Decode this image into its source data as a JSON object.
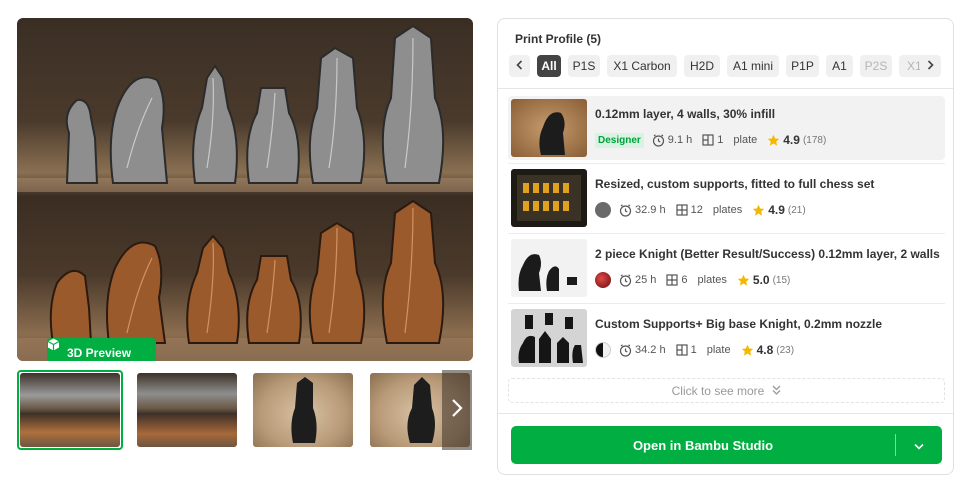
{
  "gallery": {
    "preview_button_label": "3D Preview",
    "thumbnails": [
      "thumbnail-1",
      "thumbnail-2",
      "thumbnail-3",
      "thumbnail-4"
    ],
    "selected_thumbnail": 1
  },
  "print_profile": {
    "title": "Print Profile (5)",
    "filters": [
      "All",
      "P1S",
      "X1 Carbon",
      "H2D",
      "A1 mini",
      "P1P",
      "A1",
      "P2S",
      "X1"
    ],
    "active_filter": "All",
    "items": [
      {
        "name": "0.12mm layer, 4 walls, 30% infill",
        "badge": "Designer",
        "time": "9.1 h",
        "plates_count": "1",
        "plates_label": "plate",
        "rating": "4.9",
        "rating_count": "(178)"
      },
      {
        "name": "Resized, custom supports, fitted to full chess set",
        "time": "32.9 h",
        "plates_count": "12",
        "plates_label": "plates",
        "rating": "4.9",
        "rating_count": "(21)"
      },
      {
        "name": "2 piece Knight (Better Result/Success) 0.12mm layer, 2 walls",
        "time": "25 h",
        "plates_count": "6",
        "plates_label": "plates",
        "rating": "5.0",
        "rating_count": "(15)"
      },
      {
        "name": "Custom Supports+ Big base Knight, 0.2mm nozzle",
        "time": "34.2 h",
        "plates_count": "1",
        "plates_label": "plate",
        "rating": "4.8",
        "rating_count": "(23)"
      }
    ],
    "see_more_label": "Click to see more",
    "open_button_label": "Open in Bambu Studio"
  },
  "colors": {
    "accent": "#00ae42",
    "star": "#f5b800"
  }
}
